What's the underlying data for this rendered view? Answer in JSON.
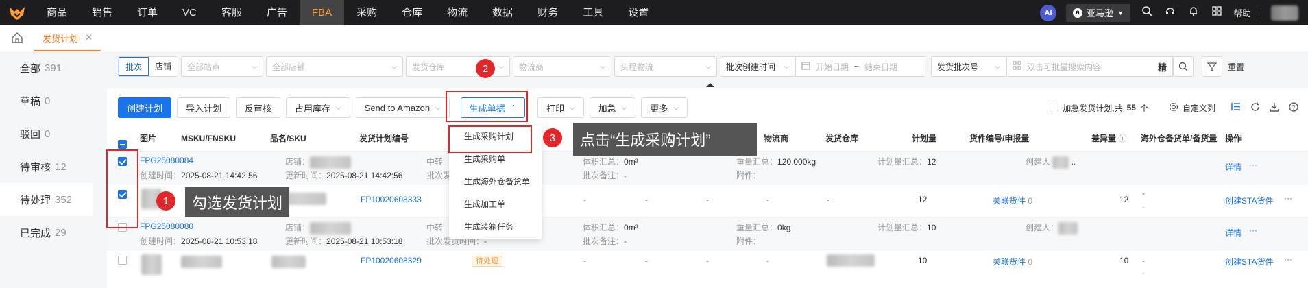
{
  "nav": {
    "items": [
      "商品",
      "销售",
      "订单",
      "VC",
      "客服",
      "广告",
      "FBA",
      "采购",
      "仓库",
      "物流",
      "数据",
      "财务",
      "工具",
      "设置"
    ],
    "active": "FBA",
    "ai_label": "AI",
    "store": "亚马逊",
    "help": "帮助"
  },
  "tabs": {
    "current": "发货计划"
  },
  "sidebar": {
    "items": [
      {
        "label": "全部",
        "count": "391"
      },
      {
        "label": "草稿",
        "count": "0"
      },
      {
        "label": "驳回",
        "count": "0"
      },
      {
        "label": "待审核",
        "count": "12"
      },
      {
        "label": "待处理",
        "count": "352"
      },
      {
        "label": "已完成",
        "count": "29"
      }
    ],
    "active_index": 4
  },
  "filters": {
    "seg_on": "批次",
    "seg_off": "店铺",
    "all_sites": "全部站点",
    "all_stores": "全部店铺",
    "warehouse": "发货仓库",
    "carrier": "物流商",
    "first_leg": "头程物流",
    "date_type": "批次创建时间",
    "start_date": "开始日期",
    "tilde": "~",
    "end_date": "结束日期",
    "search_type": "发货批次号",
    "search_placeholder": "双击可批量搜索内容",
    "precise": "精",
    "reset": "重置"
  },
  "toolbar": {
    "create": "创建计划",
    "import": "导入计划",
    "unapprove": "反审核",
    "occupy": "占用库存",
    "send_amazon": "Send to Amazon",
    "generate": "生成单据",
    "print": "打印",
    "urgent": "加急",
    "more": "更多",
    "urgent_check": "加急发货计划,共",
    "total": "55",
    "unit": "个",
    "custom_cols": "自定义列"
  },
  "columns": {
    "image": "图片",
    "msku": "MSKU/FNSKU",
    "name": "品名/SKU",
    "plan_no": "发货计划编号",
    "carrier": "物流商",
    "warehouse": "发货仓库",
    "plan_qty": "计划量",
    "shipment": "货件编号/申报量",
    "diff": "差异量",
    "overseas": "海外仓备货单/备货量",
    "action": "操作"
  },
  "dropdown": {
    "items": [
      "生成采购计划",
      "生成采购单",
      "生成海外仓备货单",
      "生成加工单",
      "生成装箱任务"
    ]
  },
  "rows": {
    "g1": {
      "batch": "FPG25080084",
      "created_label": "创建时间：",
      "created": "2025-08-21 14:42:56",
      "store_label": "店铺：",
      "updated_label": "更新时间：",
      "updated": "2025-08-21 14:42:56",
      "transit_label": "中转",
      "batch_label": "批次发",
      "volume_label": "体积汇总：",
      "volume": "0m³",
      "batch_note_label": "批次备注：",
      "batch_note": "-",
      "weight_label": "重量汇总：",
      "weight": "120.000kg",
      "attach_label": "附件：",
      "plan_total_label": "计划量汇总：",
      "plan_total": "12",
      "creator_label": "创建人",
      "action_detail": "详情",
      "action_more": "···"
    },
    "i1": {
      "plan_no": "FP10020608333",
      "c1": "-",
      "c2": "-",
      "c3": "-",
      "c4": "-",
      "c5": "-",
      "plan_qty": "12",
      "shipment": "关联货件",
      "shipment_count": "0",
      "diff": "12",
      "overseas": "-",
      "overseas2": "-",
      "action": "创建STA货件",
      "action_more": "···"
    },
    "g2": {
      "batch": "FPG25080080",
      "created_label": "创建时间：",
      "created": "2025-08-21 10:53:18",
      "store_label": "店铺：",
      "updated_label": "更新时间：",
      "updated": "2025-08-21 10:53:18",
      "transit_label": "中转",
      "batch_label": "批次发货时间：",
      "batch_time": "-",
      "volume_label": "体积汇总：",
      "volume": "0m³",
      "batch_note_label": "批次备注：",
      "batch_note": "-",
      "weight_label": "重量汇总：",
      "weight": "0kg",
      "attach_label": "附件：",
      "plan_total_label": "计划量汇总：",
      "plan_total": "10",
      "creator_label": "创建人：",
      "action_detail": "详情",
      "action_more": "···"
    },
    "i2": {
      "plan_no": "FP10020608329",
      "status": "待处理",
      "c1": "-",
      "c2": "-",
      "c3": "-",
      "c4": "-",
      "plan_qty": "10",
      "shipment": "关联货件",
      "shipment_count": "0",
      "diff": "10",
      "overseas": "-",
      "overseas2": "-",
      "action": "创建STA货件",
      "action_more": "···"
    }
  },
  "annotations": {
    "n1": "1",
    "t1": "勾选发货计划",
    "n2": "2",
    "n3": "3",
    "t3": "点击“生成采购计划”"
  },
  "colors": {
    "accent": "#1a73e8",
    "brand": "#ff7a1a",
    "annotation": "#e0282b"
  }
}
